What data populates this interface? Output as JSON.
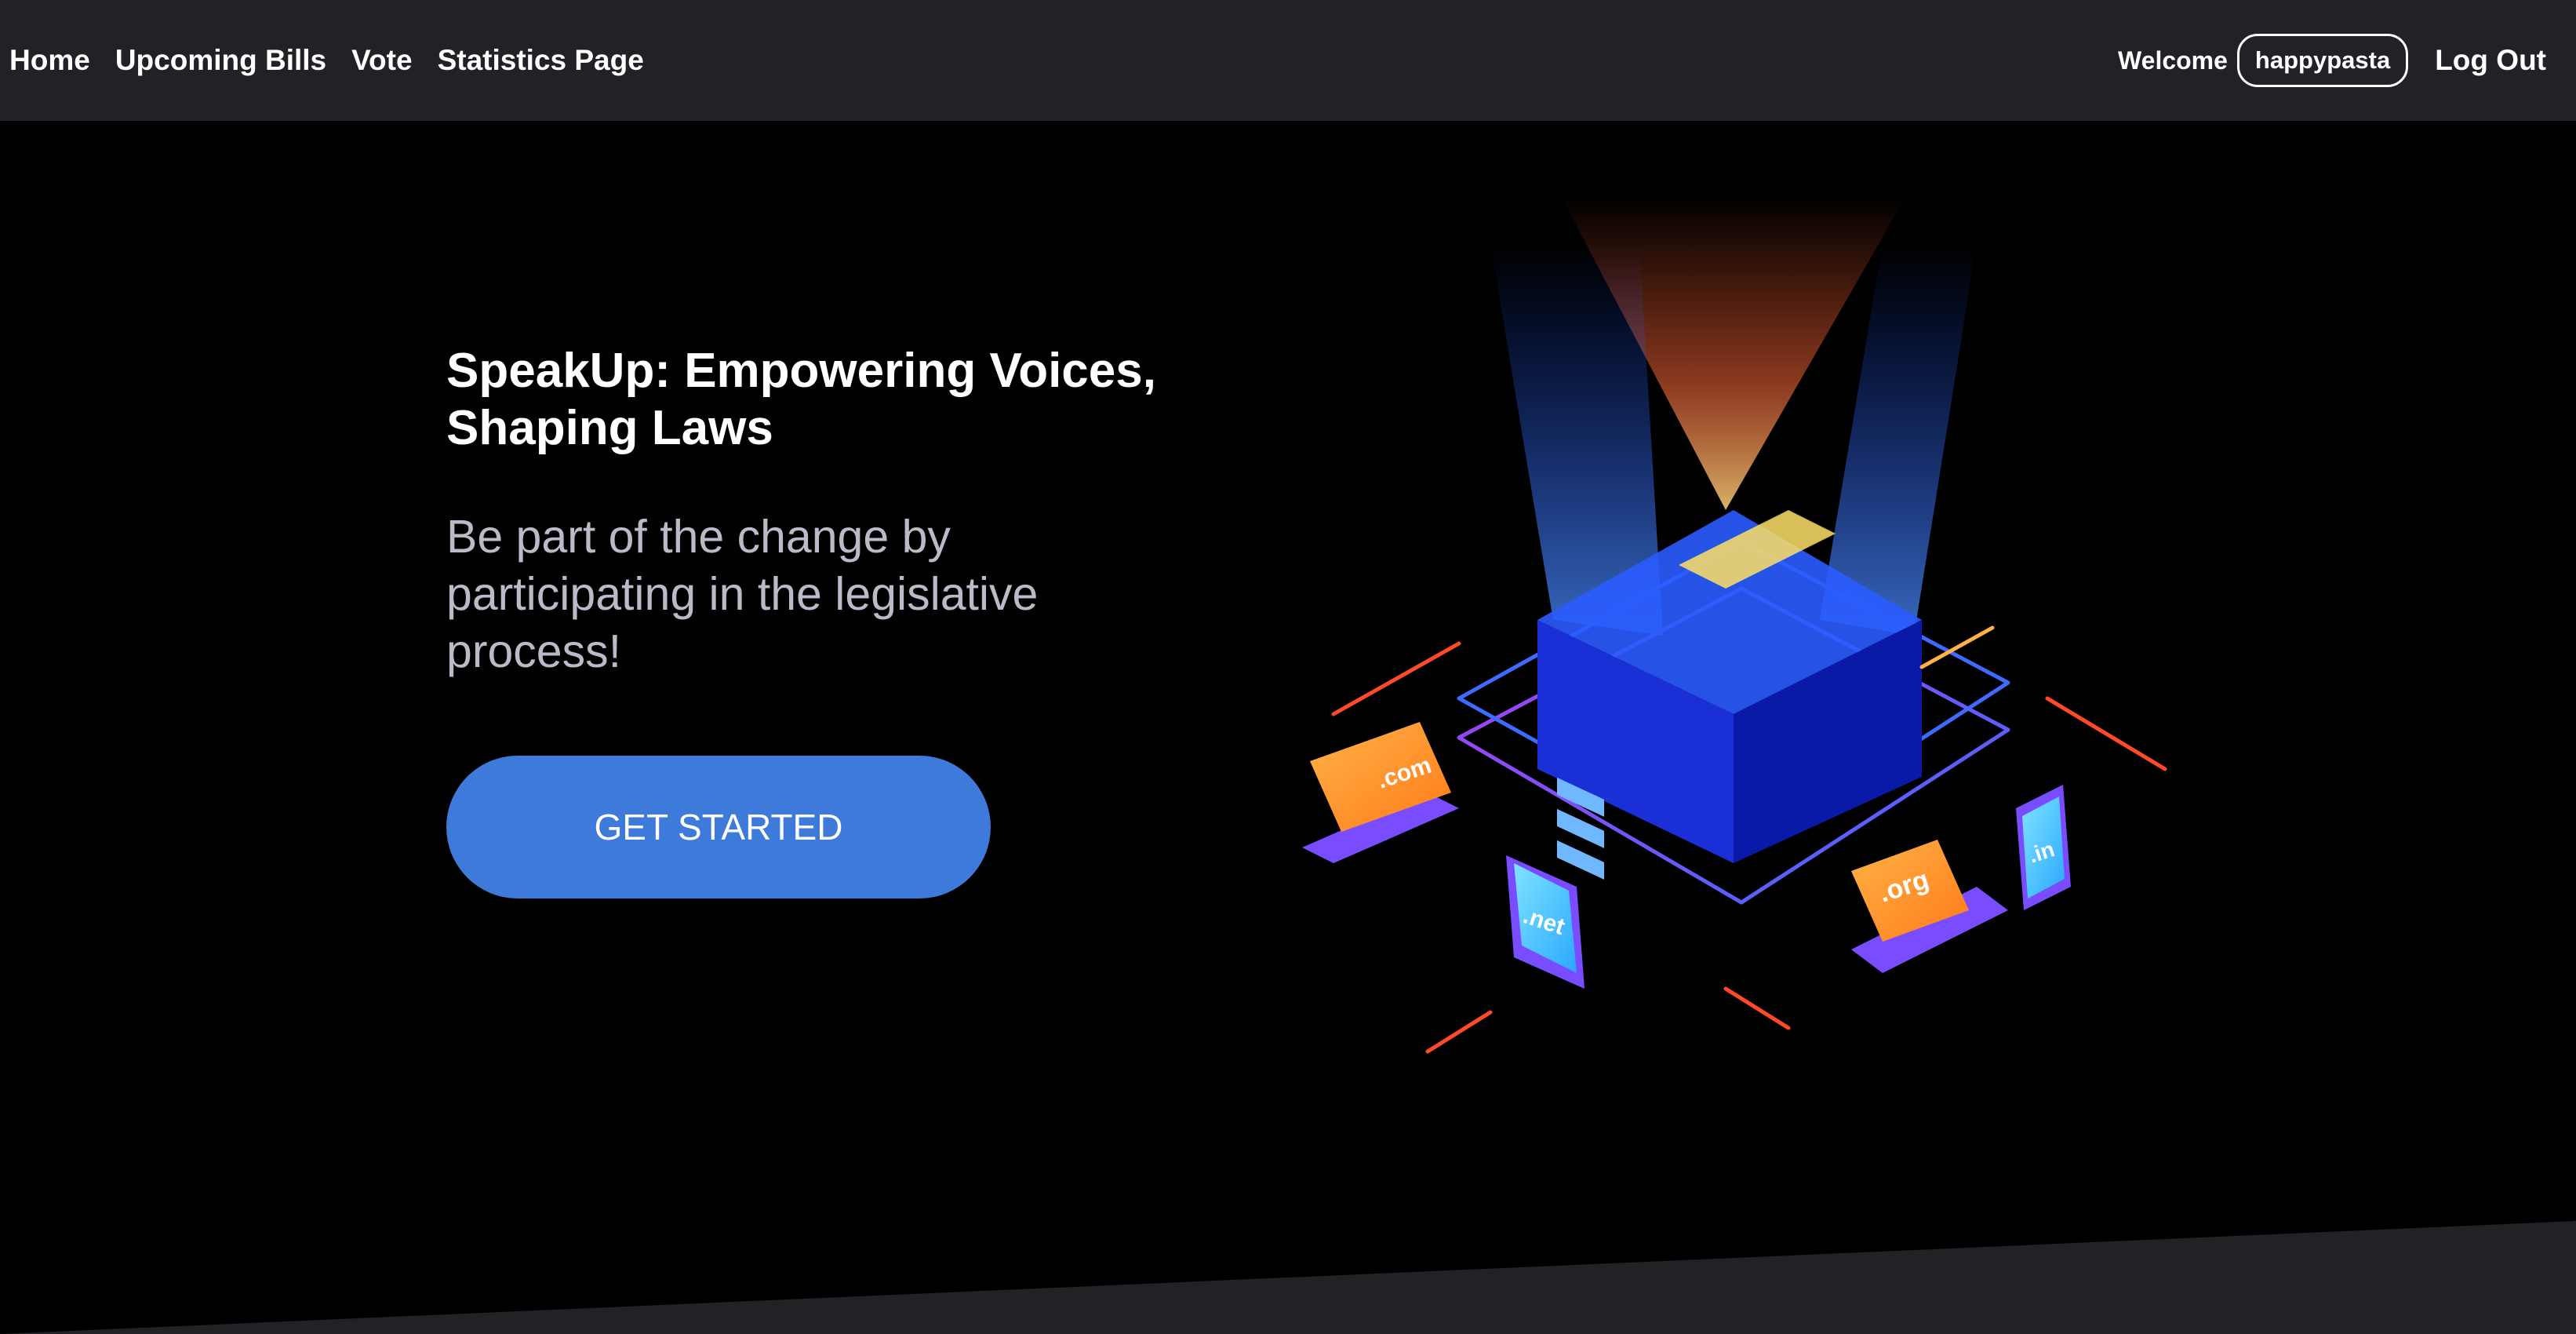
{
  "nav": {
    "links": [
      "Home",
      "Upcoming Bills",
      "Vote",
      "Statistics Page"
    ],
    "welcome": "Welcome",
    "username": "happypasta",
    "logout": "Log Out"
  },
  "hero": {
    "title": "SpeakUp: Empowering Voices, Shaping Laws",
    "subtitle": "Be part of the change by participating in the legislative process!",
    "cta": "GET STARTED"
  },
  "illustration": {
    "device_labels": [
      ".com",
      ".net",
      ".org",
      ".in"
    ]
  },
  "colors": {
    "navbar_bg": "#212226",
    "page_bg": "#000000",
    "cta_bg": "#3d7ad9",
    "subtitle_text": "#b9bcc8"
  }
}
